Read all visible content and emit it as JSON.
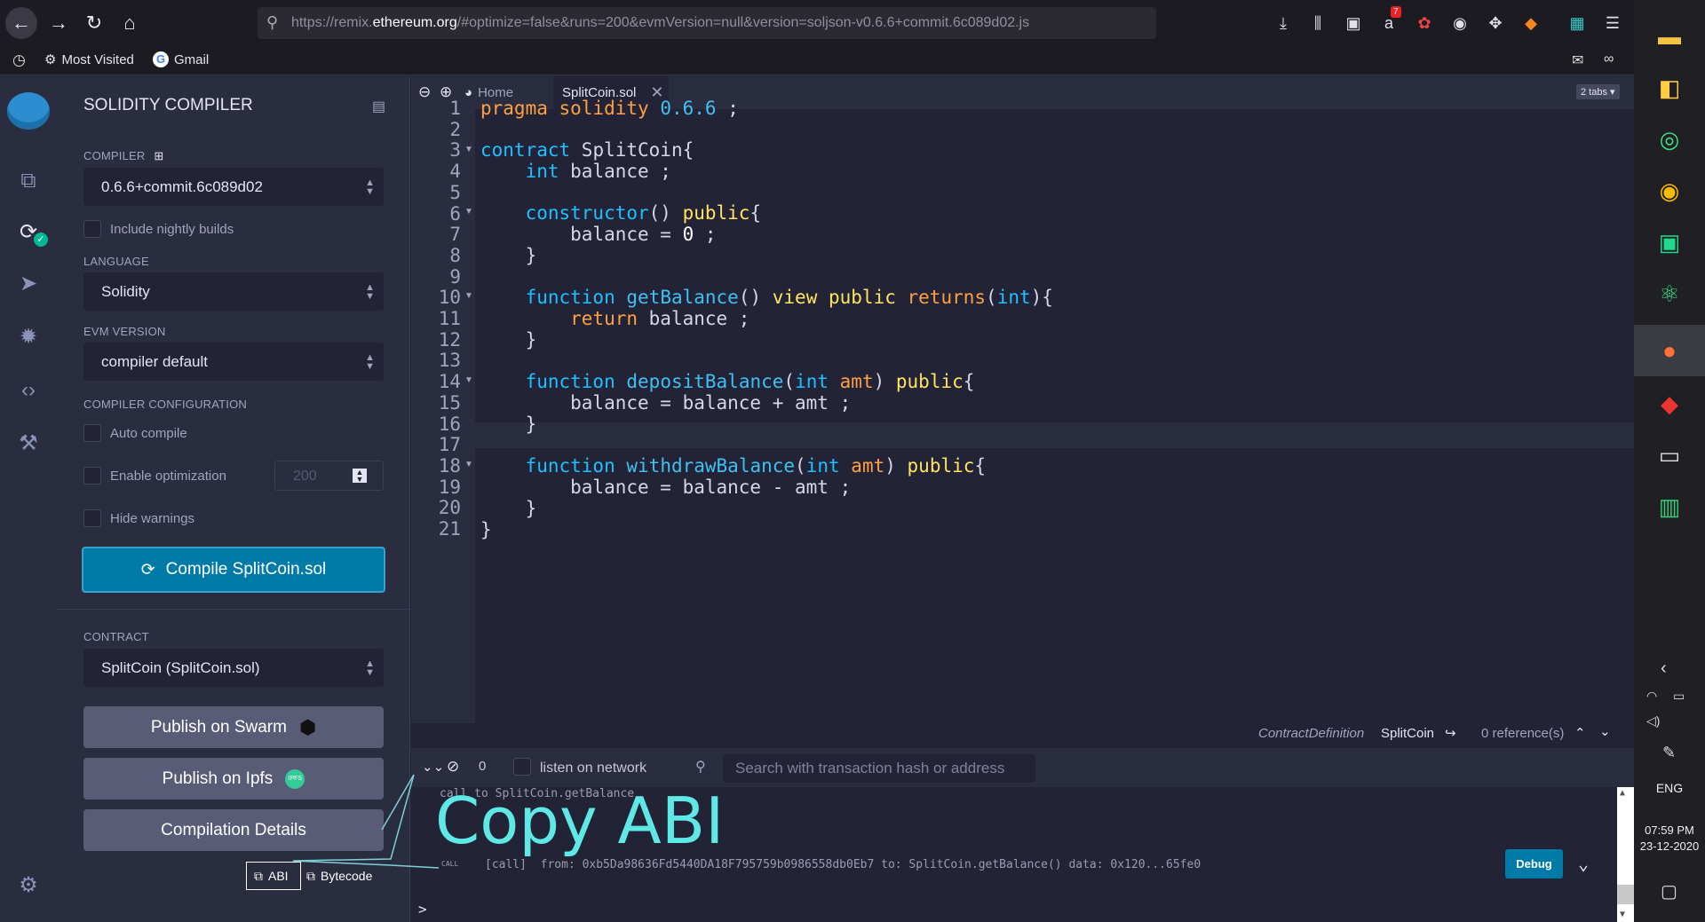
{
  "browser": {
    "url_prefix": "https://remix.",
    "url_domain": "ethereum.org",
    "url_rest": "/#optimize=false&runs=200&evmVersion=null&version=soljson-v0.6.6+commit.6c089d02.js",
    "bookmarks": [
      "Most Visited",
      "Gmail"
    ],
    "notification_badge": "7"
  },
  "side_panel": {
    "title": "SOLIDITY COMPILER",
    "compiler_label": "COMPILER",
    "compiler_value": "0.6.6+commit.6c089d02",
    "nightly_label": "Include nightly builds",
    "language_label": "LANGUAGE",
    "language_value": "Solidity",
    "evm_label": "EVM VERSION",
    "evm_value": "compiler default",
    "config_label": "COMPILER CONFIGURATION",
    "auto_compile_label": "Auto compile",
    "optimization_label": "Enable optimization",
    "runs_value": "200",
    "hide_warnings_label": "Hide warnings",
    "compile_button": "Compile SplitCoin.sol",
    "contract_label": "CONTRACT",
    "contract_value": "SplitCoin (SplitCoin.sol)",
    "publish_swarm": "Publish on Swarm",
    "publish_ipfs": "Publish on Ipfs",
    "ipfs_badge": "IPFS",
    "compilation_details": "Compilation Details",
    "abi_label": "ABI",
    "bytecode_label": "Bytecode"
  },
  "editor": {
    "home_tab": "Home",
    "file_tab": "SplitCoin.sol",
    "tabs_count": "2 tabs",
    "footer_def": "ContractDefinition",
    "footer_name": "SplitCoin",
    "footer_refs": "0 reference(s)",
    "line_numbers": [
      "1",
      "2",
      "3",
      "4",
      "5",
      "6",
      "7",
      "8",
      "9",
      "10",
      "11",
      "12",
      "13",
      "14",
      "15",
      "16",
      "17",
      "18",
      "19",
      "20",
      "21"
    ]
  },
  "terminal": {
    "count": "0",
    "listen_label": "listen on network",
    "search_placeholder": "Search with transaction hash or address",
    "call_line_1": "call to SplitCoin.getBalance",
    "call_tag": "CALL",
    "call_line_2": "[call]  from: 0xb5Da98636Fd5440DA18F795759b0986558db0Eb7 to: SplitCoin.getBalance() data: 0x120...65fe0",
    "debug_button": "Debug",
    "prompt": ">"
  },
  "annotation": {
    "text": "Copy ABI"
  },
  "taskbar": {
    "language": "ENG",
    "time": "07:59 PM",
    "date": "23-12-2020"
  },
  "colors": {
    "accent": "#007aa6",
    "annotation": "#5ee8e6"
  }
}
